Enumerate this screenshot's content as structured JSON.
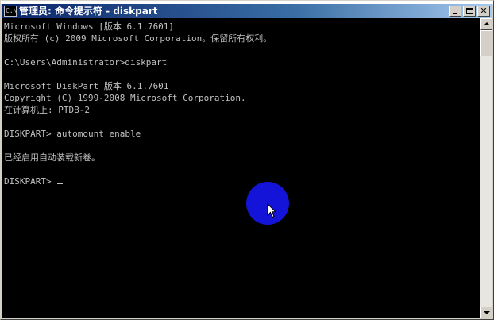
{
  "window": {
    "title": "管理员: 命令提示符 - diskpart",
    "icon_label": "C:\\"
  },
  "console": {
    "lines": [
      "Microsoft Windows [版本 6.1.7601]",
      "版权所有 (c) 2009 Microsoft Corporation。保留所有权利。",
      "",
      "C:\\Users\\Administrator>diskpart",
      "",
      "Microsoft DiskPart 版本 6.1.7601",
      "Copyright (C) 1999-2008 Microsoft Corporation.",
      "在计算机上: PTDB-2",
      "",
      "DISKPART> automount enable",
      "",
      "已经启用自动装载新卷。",
      "",
      "DISKPART> "
    ]
  },
  "colors": {
    "console_background": "#000000",
    "console_text": "#c0c0c0",
    "titlebar_start": "#0a246a",
    "click_indicator": "#1414d8"
  },
  "icons": {
    "window_icon": "cmd-icon",
    "minimize": "minimize-icon",
    "maximize": "maximize-icon",
    "close": "close-icon",
    "scroll_up": "arrow-up-icon",
    "scroll_down": "arrow-down-icon",
    "pointer": "mouse-pointer-icon"
  }
}
